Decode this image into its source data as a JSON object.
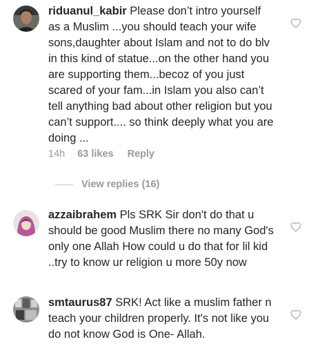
{
  "comments": [
    {
      "username": "riduanul_kabir",
      "text": "Please don’t intro yourself as a Muslim ...you should teach your wife sons,daughter about Islam and not to do blv in this kind of statue...on the other hand you are supporting them...becoz of you just scared of your fam...in Islam you also can’t tell anything bad about other religion but you can’t support.... so think deeply what you are doing ...",
      "time": "14h",
      "likes": "63 likes",
      "reply": "Reply",
      "view_replies": "View replies (16)"
    },
    {
      "username": "azzaibrahem",
      "text": "Pls SRK Sir don't do that u should be good Muslim there no many God's only one Allah How could u do that for lil kid ..try to know ur religion  u more 50y now"
    },
    {
      "username": "smtaurus87",
      "text": "SRK! Act like a muslim father n teach your children properly. It's not like you do not know God is One- Allah."
    }
  ],
  "colors": {
    "text": "#262626",
    "secondary": "#999999",
    "heart_outline": "#b0b0b0"
  },
  "icons": {
    "like": "heart-outline-icon"
  }
}
